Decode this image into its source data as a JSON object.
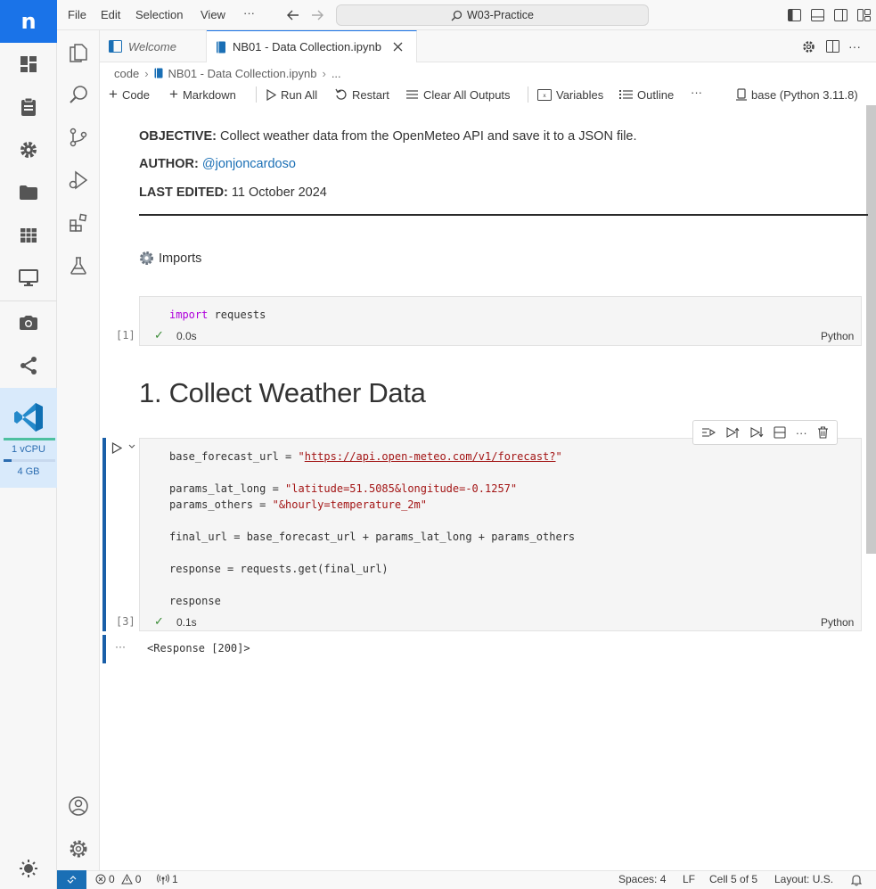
{
  "menu": [
    "File",
    "Edit",
    "Selection",
    "View",
    "···"
  ],
  "search": {
    "label": "W03-Practice"
  },
  "tabs": [
    {
      "label": "Welcome"
    },
    {
      "label": "NB01 - Data Collection.ipynb"
    }
  ],
  "breadcrumb": [
    "code",
    "NB01 - Data Collection.ipynb",
    "..."
  ],
  "toolbar": {
    "code": "Code",
    "markdown": "Markdown",
    "run_all": "Run All",
    "restart": "Restart",
    "clear": "Clear All Outputs",
    "variables": "Variables",
    "outline": "Outline",
    "more": "···",
    "kernel": "base (Python 3.11.8)"
  },
  "noteable": {
    "logo": "n",
    "cpu": "1 vCPU",
    "memory": "4 GB",
    "cpu_fraction": 1.0,
    "mem_fraction": 0.15
  },
  "markdown": {
    "objective_label": "OBJECTIVE:",
    "objective_text": "Collect weather data from the OpenMeteo API and save it to a JSON file.",
    "author_label": "AUTHOR:",
    "author_link": "@jonjoncardoso",
    "edited_label": "LAST EDITED:",
    "edited_text": "11 October 2024",
    "imports_heading": "Imports",
    "section_heading": "1. Collect Weather Data"
  },
  "cell1": {
    "keyword": "import",
    "rest": " requests",
    "exec_count": "[1]",
    "duration": "0.0s",
    "language": "Python"
  },
  "cell3": {
    "line1_var": "base_forecast_url = ",
    "line1_q1": "\"",
    "line1_url": "https://api.open-meteo.com/v1/forecast?",
    "line1_q2": "\"",
    "line2_var": "params_lat_long = ",
    "line2_str": "\"latitude=51.5085&longitude=-0.1257\"",
    "line3_var": "params_others = ",
    "line3_str": "\"&hourly=temperature_2m\"",
    "line4": "final_url = base_forecast_url + params_lat_long + params_others",
    "line5": "response = requests.get(final_url)",
    "line6": "response",
    "exec_count": "[3]",
    "duration": "0.1s",
    "language": "Python",
    "output": "<Response [200]>",
    "output_more": "···"
  },
  "status": {
    "errors": "0",
    "warnings": "0",
    "ports": "1",
    "spaces": "Spaces: 4",
    "eol": "LF",
    "cell": "Cell 5 of 5",
    "layout": "Layout: U.S."
  },
  "colors": {
    "accent": "#1a73e8",
    "focus": "#1a5fa8",
    "keyword": "#af00db",
    "string": "#a31515",
    "success": "#388a34"
  }
}
